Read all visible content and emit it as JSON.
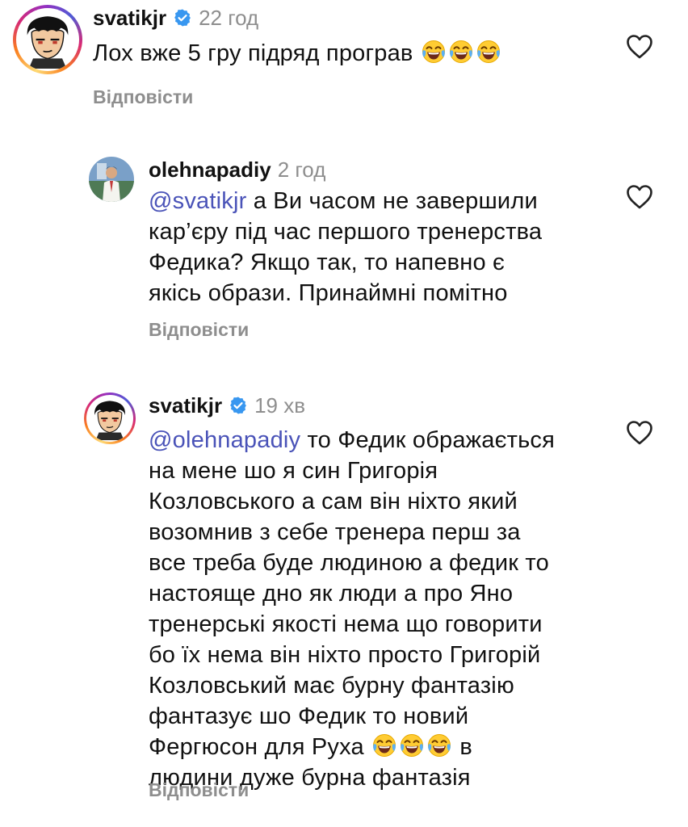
{
  "comments": [
    {
      "username": "svatikjr",
      "verified": true,
      "time": "22 год",
      "mention": "",
      "lines": [
        "Лох вже 5 гру підряд програв"
      ],
      "reply_label": "Відповісти"
    },
    {
      "username": "olehnapadiy",
      "verified": false,
      "time": "2 год",
      "mention": "@svatikjr",
      "lines": [
        " а Ви часом не завершили",
        "кар’єру під час першого тренерства",
        "Федика? Якщо так, то напевно є",
        "якісь образи. Принаймні помітно"
      ],
      "reply_label": "Відповісти"
    },
    {
      "username": "svatikjr",
      "verified": true,
      "time": "19 хв",
      "mention": "@olehnapadiy",
      "lines": [
        " то Федик ображається",
        "на мене шо я син Григорія",
        "Козловського а сам він ніхто який",
        "возомнив з себе тренера перш за",
        "все треба буде людиною а федик то",
        "настояще дно як люди а про Яно",
        "тренерські якості нема що говорити",
        "бо їх нема він ніхто просто Григорій",
        "Козловський має бурну фантазію",
        "фантазує шо Федик то новий",
        "Фергюсон для Руха",
        "в",
        "людини дуже бурна фантазія"
      ],
      "reply_label": "Відповісти"
    }
  ],
  "icons": {
    "verified": "verified-badge-icon",
    "like": "heart-outline-icon",
    "emoji": "face-with-tears-of-joy-icon"
  },
  "colors": {
    "mention": "#4a53b8",
    "verified": "#3897f0",
    "meta": "#8e8e8e"
  }
}
